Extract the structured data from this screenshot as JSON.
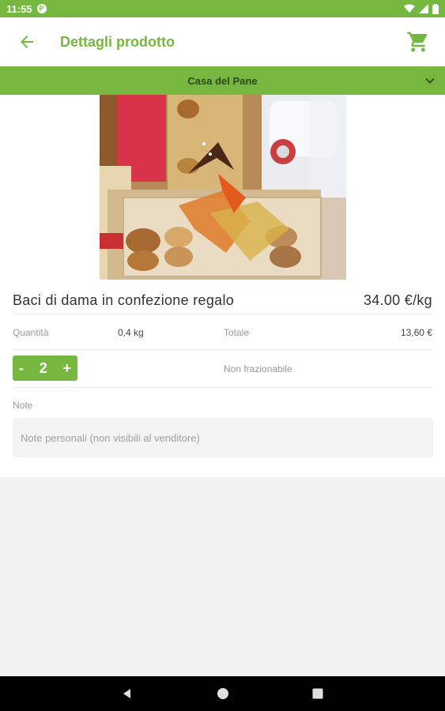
{
  "status_bar": {
    "time": "11:55",
    "notif_letter": "P"
  },
  "header": {
    "title": "Dettagli prodotto"
  },
  "shop": {
    "name": "Casa del Pane"
  },
  "product": {
    "name": "Baci di dama in confezione regalo",
    "price": "34.00 €/kg",
    "quantity_label": "Quantità",
    "quantity_value": "0,4 kg",
    "total_label": "Totale",
    "total_value": "13,60 €",
    "stepper": {
      "minus": "-",
      "value": "2",
      "plus": "+"
    },
    "divisibility": "Non frazionabile"
  },
  "notes": {
    "label": "Note",
    "placeholder": "Note personali (non visibili al venditore)"
  },
  "colors": {
    "accent": "#76b83f",
    "nav": "#000000"
  },
  "icons": [
    "back-arrow-icon",
    "cart-icon",
    "chevron-down-icon",
    "nav-back-icon",
    "nav-home-icon",
    "nav-recents-icon"
  ]
}
